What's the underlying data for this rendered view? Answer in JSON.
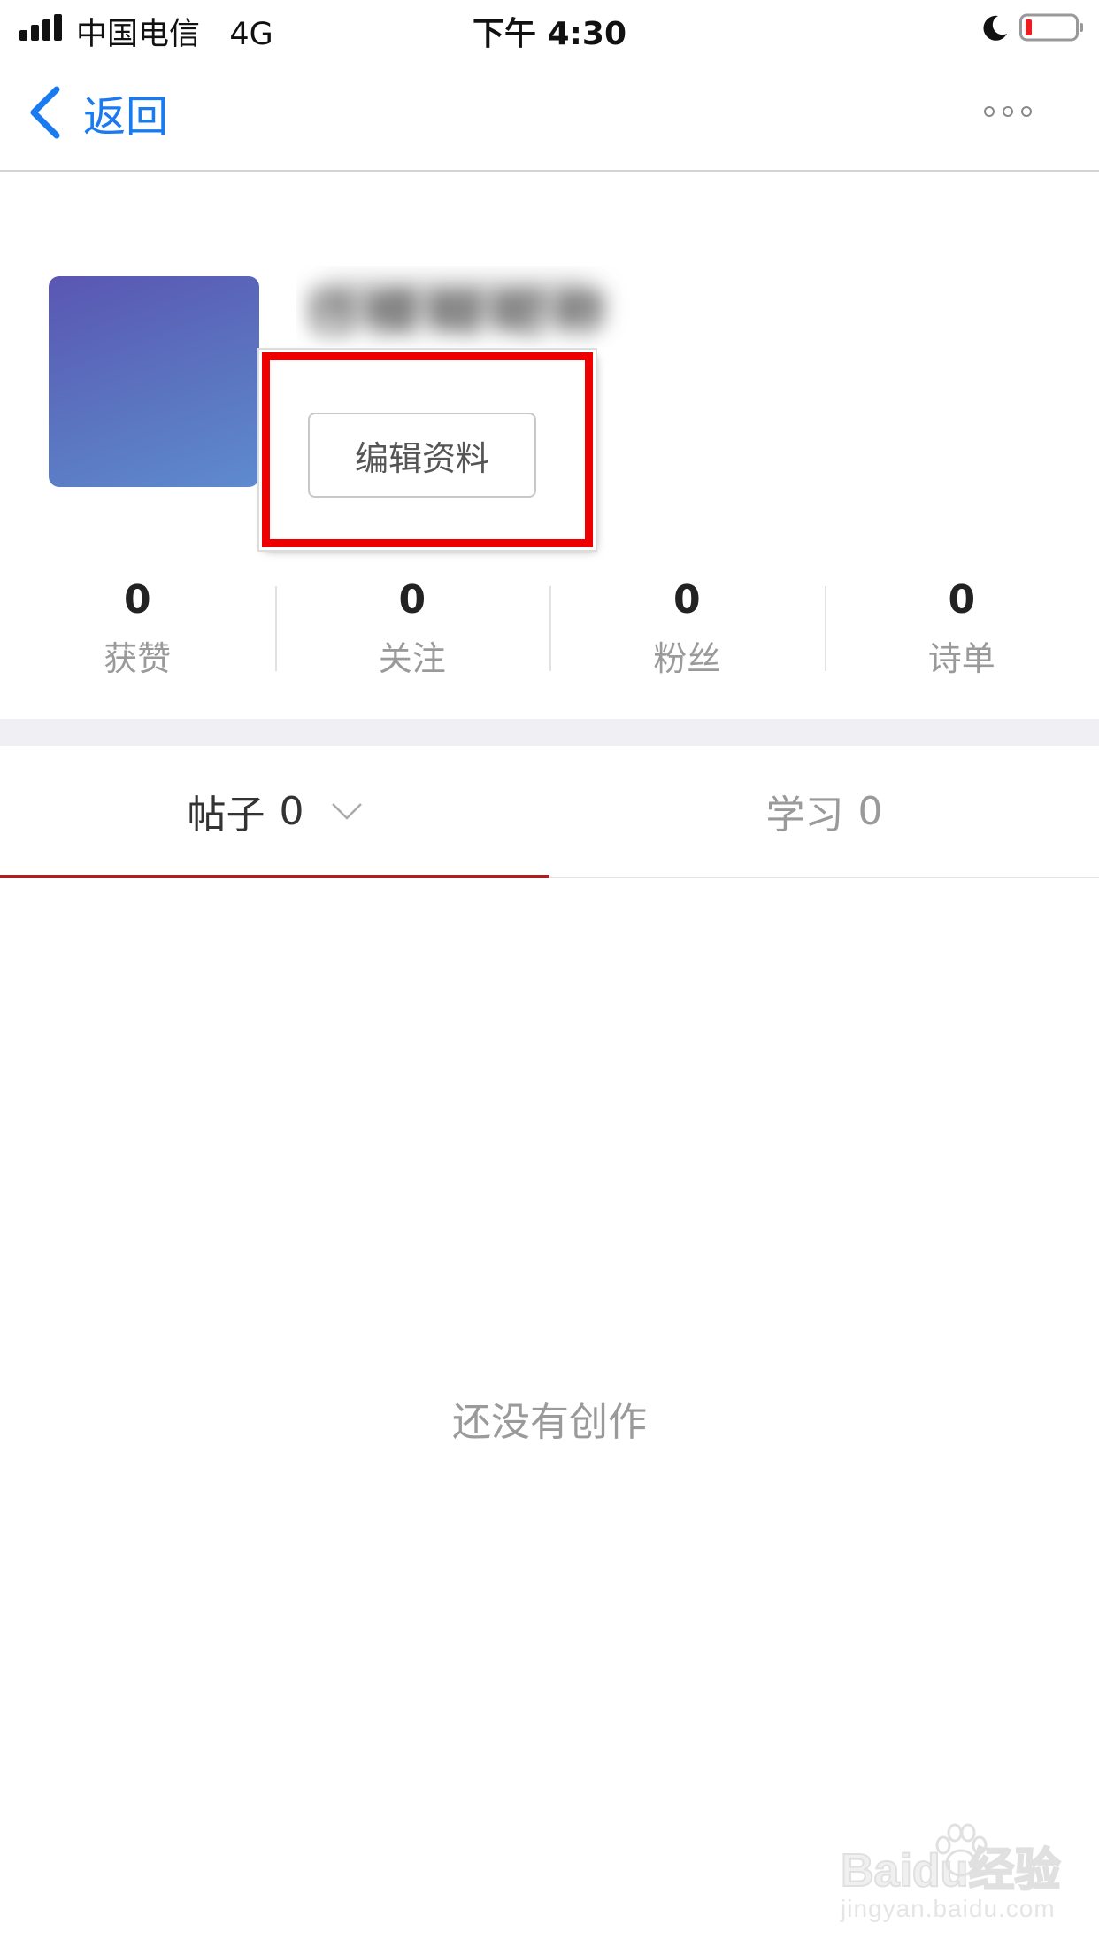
{
  "status_bar": {
    "carrier": "中国电信",
    "network": "4G",
    "time": "下午 4:30",
    "signal_bars": 4,
    "battery_level": 0.1,
    "icons": [
      "signal-icon",
      "moon-icon",
      "battery-icon"
    ]
  },
  "nav": {
    "back_label": "返回",
    "back_icon": "chevron-left-icon",
    "more_icon": "more-dots-icon",
    "accent_color": "#1a7bf0"
  },
  "profile": {
    "avatar_colors": [
      "#5a56b2",
      "#5e8bd0"
    ],
    "username_blurred": "已 模 糊 昵 称",
    "edit_button_label": "编辑资料"
  },
  "stats": [
    {
      "value": "0",
      "label": "获赞"
    },
    {
      "value": "0",
      "label": "关注"
    },
    {
      "value": "0",
      "label": "粉丝"
    },
    {
      "value": "0",
      "label": "诗单"
    }
  ],
  "tabs": [
    {
      "label": "帖子",
      "count": "0",
      "active": true
    },
    {
      "label": "学习",
      "count": "0",
      "active": false
    }
  ],
  "tab_accent_color": "#a82020",
  "empty_state": "还没有创作",
  "watermark": {
    "logo_text": "Baidu经验",
    "url": "jingyan.baidu.com"
  },
  "highlight_color": "#ee0000"
}
